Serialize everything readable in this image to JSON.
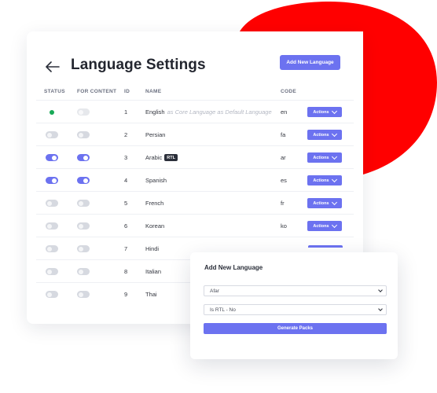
{
  "page": {
    "title": "Language Settings",
    "add_button_label": "Add New Language"
  },
  "table": {
    "headers": {
      "status": "STATUS",
      "for_content": "FOR CONTENT",
      "id": "ID",
      "name": "NAME",
      "code": "CODE"
    },
    "actions_label": "Actions",
    "rows": [
      {
        "id": "1",
        "name": "English",
        "note": "as Core Language as Default Language",
        "code": "en",
        "status": "core",
        "for_content": false,
        "rtl": false
      },
      {
        "id": "2",
        "name": "Persian",
        "note": "",
        "code": "fa",
        "status": false,
        "for_content": false,
        "rtl": false
      },
      {
        "id": "3",
        "name": "Arabic",
        "note": "",
        "code": "ar",
        "status": true,
        "for_content": true,
        "rtl": true
      },
      {
        "id": "4",
        "name": "Spanish",
        "note": "",
        "code": "es",
        "status": true,
        "for_content": true,
        "rtl": false
      },
      {
        "id": "5",
        "name": "French",
        "note": "",
        "code": "fr",
        "status": false,
        "for_content": false,
        "rtl": false
      },
      {
        "id": "6",
        "name": "Korean",
        "note": "",
        "code": "ko",
        "status": false,
        "for_content": false,
        "rtl": false
      },
      {
        "id": "7",
        "name": "Hindi",
        "note": "",
        "code": "",
        "status": false,
        "for_content": false,
        "rtl": false
      },
      {
        "id": "8",
        "name": "Italian",
        "note": "",
        "code": "",
        "status": false,
        "for_content": false,
        "rtl": false
      },
      {
        "id": "9",
        "name": "Thai",
        "note": "",
        "code": "",
        "status": false,
        "for_content": false,
        "rtl": false
      }
    ],
    "rtl_badge": "RTL"
  },
  "modal": {
    "title": "Add New Language",
    "language_select": "Afar",
    "rtl_select": "Is RTL - No",
    "generate_button": "Generate Packs"
  },
  "colors": {
    "accent": "#6c72f0",
    "blob": "#ff0000",
    "status_active": "#18a957"
  }
}
